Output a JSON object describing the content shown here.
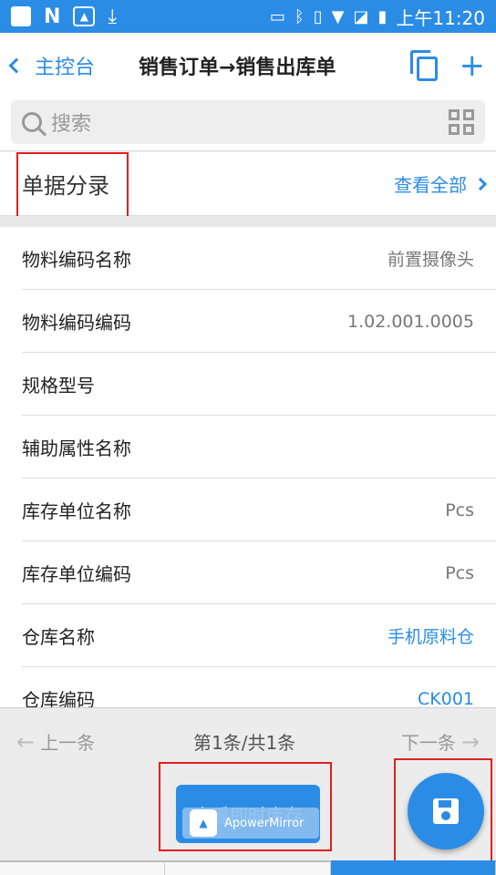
{
  "status_bar": {
    "time": "上午11:20",
    "left_icons": [
      "app-icon",
      "n-icon",
      "mirror-icon",
      "download-icon"
    ],
    "right_icons": [
      "cast-icon",
      "bluetooth-icon",
      "vibrate-icon",
      "wifi-icon",
      "no-sim-icon",
      "battery-icon"
    ]
  },
  "nav": {
    "back_label": "主控台",
    "title": "销售订单→销售出库单"
  },
  "search": {
    "placeholder": "搜索"
  },
  "section": {
    "title": "单据分录",
    "view_all": "查看全部"
  },
  "rows": [
    {
      "label": "物料编码名称",
      "value": "前置摄像头"
    },
    {
      "label": "物料编码编码",
      "value": "1.02.001.0005"
    },
    {
      "label": "规格型号",
      "value": ""
    },
    {
      "label": "辅助属性名称",
      "value": ""
    },
    {
      "label": "库存单位名称",
      "value": "Pcs"
    },
    {
      "label": "库存单位编码",
      "value": "Pcs"
    },
    {
      "label": "仓库名称",
      "value": "手机原料仓"
    },
    {
      "label": "仓库编码",
      "value": "CK001"
    }
  ],
  "pager": {
    "prev": "上一条",
    "info": "第1条/共1条",
    "next": "下一条"
  },
  "bottom": {
    "stock_button": "查看即时库存",
    "watermark": "ApowerMirror"
  },
  "colors": {
    "accent": "#2b8ce6",
    "highlight_box": "#e02020"
  }
}
